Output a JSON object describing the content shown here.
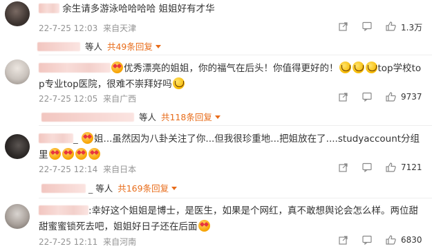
{
  "comments": [
    {
      "text": "余生请多游泳哈哈哈哈 姐姐好有才华",
      "time": "22-7-25 12:03",
      "location": "来自天津",
      "likes": "1.3万",
      "replies_by": "等人",
      "replies_count": "共49条回复"
    },
    {
      "text_a": "优秀漂亮的姐姐，你的福气在后头！你值得更好的！",
      "text_b": "top学校top专业top医院，很难不崇拜好吗",
      "time": "22-7-25 12:05",
      "location": "来自广西",
      "likes": "9737",
      "replies_by": "等人",
      "replies_count": "共118条回复"
    },
    {
      "text_a": "姐...虽然因为八卦关注了你...但我很珍重地...把姐放在了....studyaccount分组里",
      "time": "22-7-25 12:14",
      "location": "来自日本",
      "likes": "7121",
      "replies_by": "等人",
      "replies_count": "共169条回复"
    },
    {
      "text": "幸好这个姐姐是博士，是医生，如果是个网红，真不敢想舆论会怎么样。两位甜甜蜜蜜锁死去吧，姐姐好日子还在后面",
      "time": "22-7-25 12:11",
      "location": "来自河南",
      "likes": "6830"
    }
  ],
  "icons": {
    "share": "share-icon",
    "comment": "comment-icon",
    "like": "like-icon"
  },
  "colors": {
    "accent": "#e86c1a",
    "meta": "#939393"
  }
}
